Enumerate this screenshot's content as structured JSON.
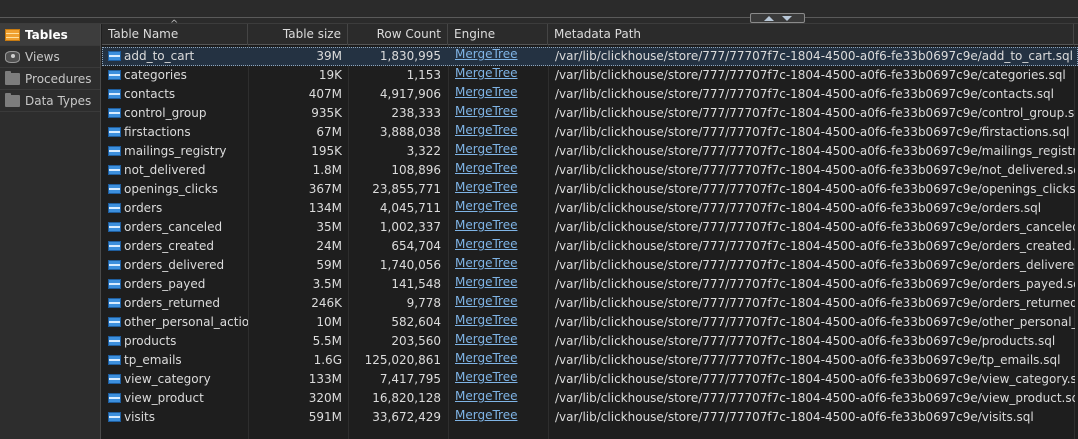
{
  "sidebar": {
    "items": [
      {
        "label": "Tables",
        "icon": "table-icon",
        "active": true
      },
      {
        "label": "Views",
        "icon": "view-icon",
        "active": false
      },
      {
        "label": "Procedures",
        "icon": "folder-icon",
        "active": false
      },
      {
        "label": "Data Types",
        "icon": "folder-icon",
        "active": false
      }
    ]
  },
  "header": {
    "table_name": "Table Name",
    "table_size": "Table size",
    "row_count": "Row Count",
    "engine": "Engine",
    "metadata_path": "Metadata Path"
  },
  "colors": {
    "selection": "#243242",
    "link": "#7fb4e6",
    "table_icon": "#3c8fdd",
    "tables_icon": "#f0a030"
  },
  "rows": [
    {
      "name": "add_to_cart",
      "size": "39M",
      "count": "1,830,995",
      "engine": "MergeTree",
      "path": "/var/lib/clickhouse/store/777/77707f7c-1804-4500-a0f6-fe33b0697c9e/add_to_cart.sql"
    },
    {
      "name": "categories",
      "size": "19K",
      "count": "1,153",
      "engine": "MergeTree",
      "path": "/var/lib/clickhouse/store/777/77707f7c-1804-4500-a0f6-fe33b0697c9e/categories.sql"
    },
    {
      "name": "contacts",
      "size": "407M",
      "count": "4,917,906",
      "engine": "MergeTree",
      "path": "/var/lib/clickhouse/store/777/77707f7c-1804-4500-a0f6-fe33b0697c9e/contacts.sql"
    },
    {
      "name": "control_group",
      "size": "935K",
      "count": "238,333",
      "engine": "MergeTree",
      "path": "/var/lib/clickhouse/store/777/77707f7c-1804-4500-a0f6-fe33b0697c9e/control_group.sql"
    },
    {
      "name": "firstactions",
      "size": "67M",
      "count": "3,888,038",
      "engine": "MergeTree",
      "path": "/var/lib/clickhouse/store/777/77707f7c-1804-4500-a0f6-fe33b0697c9e/firstactions.sql"
    },
    {
      "name": "mailings_registry",
      "size": "195K",
      "count": "3,322",
      "engine": "MergeTree",
      "path": "/var/lib/clickhouse/store/777/77707f7c-1804-4500-a0f6-fe33b0697c9e/mailings_registry.sql"
    },
    {
      "name": "not_delivered",
      "size": "1.8M",
      "count": "108,896",
      "engine": "MergeTree",
      "path": "/var/lib/clickhouse/store/777/77707f7c-1804-4500-a0f6-fe33b0697c9e/not_delivered.sql"
    },
    {
      "name": "openings_clicks",
      "size": "367M",
      "count": "23,855,771",
      "engine": "MergeTree",
      "path": "/var/lib/clickhouse/store/777/77707f7c-1804-4500-a0f6-fe33b0697c9e/openings_clicks.sql"
    },
    {
      "name": "orders",
      "size": "134M",
      "count": "4,045,711",
      "engine": "MergeTree",
      "path": "/var/lib/clickhouse/store/777/77707f7c-1804-4500-a0f6-fe33b0697c9e/orders.sql"
    },
    {
      "name": "orders_canceled",
      "size": "35M",
      "count": "1,002,337",
      "engine": "MergeTree",
      "path": "/var/lib/clickhouse/store/777/77707f7c-1804-4500-a0f6-fe33b0697c9e/orders_canceled.sql"
    },
    {
      "name": "orders_created",
      "size": "24M",
      "count": "654,704",
      "engine": "MergeTree",
      "path": "/var/lib/clickhouse/store/777/77707f7c-1804-4500-a0f6-fe33b0697c9e/orders_created.sql"
    },
    {
      "name": "orders_delivered",
      "size": "59M",
      "count": "1,740,056",
      "engine": "MergeTree",
      "path": "/var/lib/clickhouse/store/777/77707f7c-1804-4500-a0f6-fe33b0697c9e/orders_delivered.sql"
    },
    {
      "name": "orders_payed",
      "size": "3.5M",
      "count": "141,548",
      "engine": "MergeTree",
      "path": "/var/lib/clickhouse/store/777/77707f7c-1804-4500-a0f6-fe33b0697c9e/orders_payed.sql"
    },
    {
      "name": "orders_returned",
      "size": "246K",
      "count": "9,778",
      "engine": "MergeTree",
      "path": "/var/lib/clickhouse/store/777/77707f7c-1804-4500-a0f6-fe33b0697c9e/orders_returned.sql"
    },
    {
      "name": "other_personal_actions",
      "size": "10M",
      "count": "582,604",
      "engine": "MergeTree",
      "path": "/var/lib/clickhouse/store/777/77707f7c-1804-4500-a0f6-fe33b0697c9e/other_personal_actions.sql"
    },
    {
      "name": "products",
      "size": "5.5M",
      "count": "203,560",
      "engine": "MergeTree",
      "path": "/var/lib/clickhouse/store/777/77707f7c-1804-4500-a0f6-fe33b0697c9e/products.sql"
    },
    {
      "name": "tp_emails",
      "size": "1.6G",
      "count": "125,020,861",
      "engine": "MergeTree",
      "path": "/var/lib/clickhouse/store/777/77707f7c-1804-4500-a0f6-fe33b0697c9e/tp_emails.sql"
    },
    {
      "name": "view_category",
      "size": "133M",
      "count": "7,417,795",
      "engine": "MergeTree",
      "path": "/var/lib/clickhouse/store/777/77707f7c-1804-4500-a0f6-fe33b0697c9e/view_category.sql"
    },
    {
      "name": "view_product",
      "size": "320M",
      "count": "16,820,128",
      "engine": "MergeTree",
      "path": "/var/lib/clickhouse/store/777/77707f7c-1804-4500-a0f6-fe33b0697c9e/view_product.sql"
    },
    {
      "name": "visits",
      "size": "591M",
      "count": "33,672,429",
      "engine": "MergeTree",
      "path": "/var/lib/clickhouse/store/777/77707f7c-1804-4500-a0f6-fe33b0697c9e/visits.sql"
    }
  ]
}
